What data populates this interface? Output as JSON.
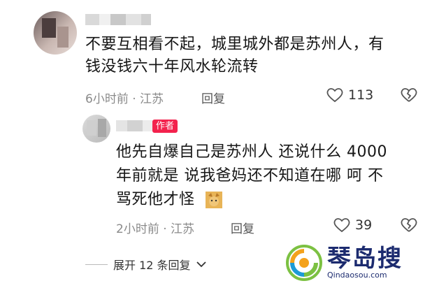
{
  "top_comment": {
    "text_line1": "不要互相看不起，城里城外都是苏州人，有",
    "text_line2": "钱没钱六十年风水轮流转",
    "time_location": "6小时前 · 江苏",
    "reply_label": "回复",
    "like_count": "113"
  },
  "reply": {
    "author_badge": "作者",
    "text_line1": "他先自爆自己是苏州人 还说什么 4000",
    "text_line2": "年前就是 说我爸妈还不知道在哪 呵 不",
    "text_line3": "骂死他才怪",
    "time_location": "2小时前 · 江苏",
    "reply_label": "回复",
    "like_count": "39"
  },
  "expand": {
    "label": "展开 12 条回复"
  },
  "watermark": {
    "name": "琴岛搜",
    "url": "Qindaosou.com"
  },
  "icons": {
    "like": "heart-outline-icon",
    "dislike": "broken-heart-icon",
    "expand": "chevron-down-icon",
    "emoji": "cat-emoji-icon",
    "logo": "qindaosou-logo-icon"
  }
}
